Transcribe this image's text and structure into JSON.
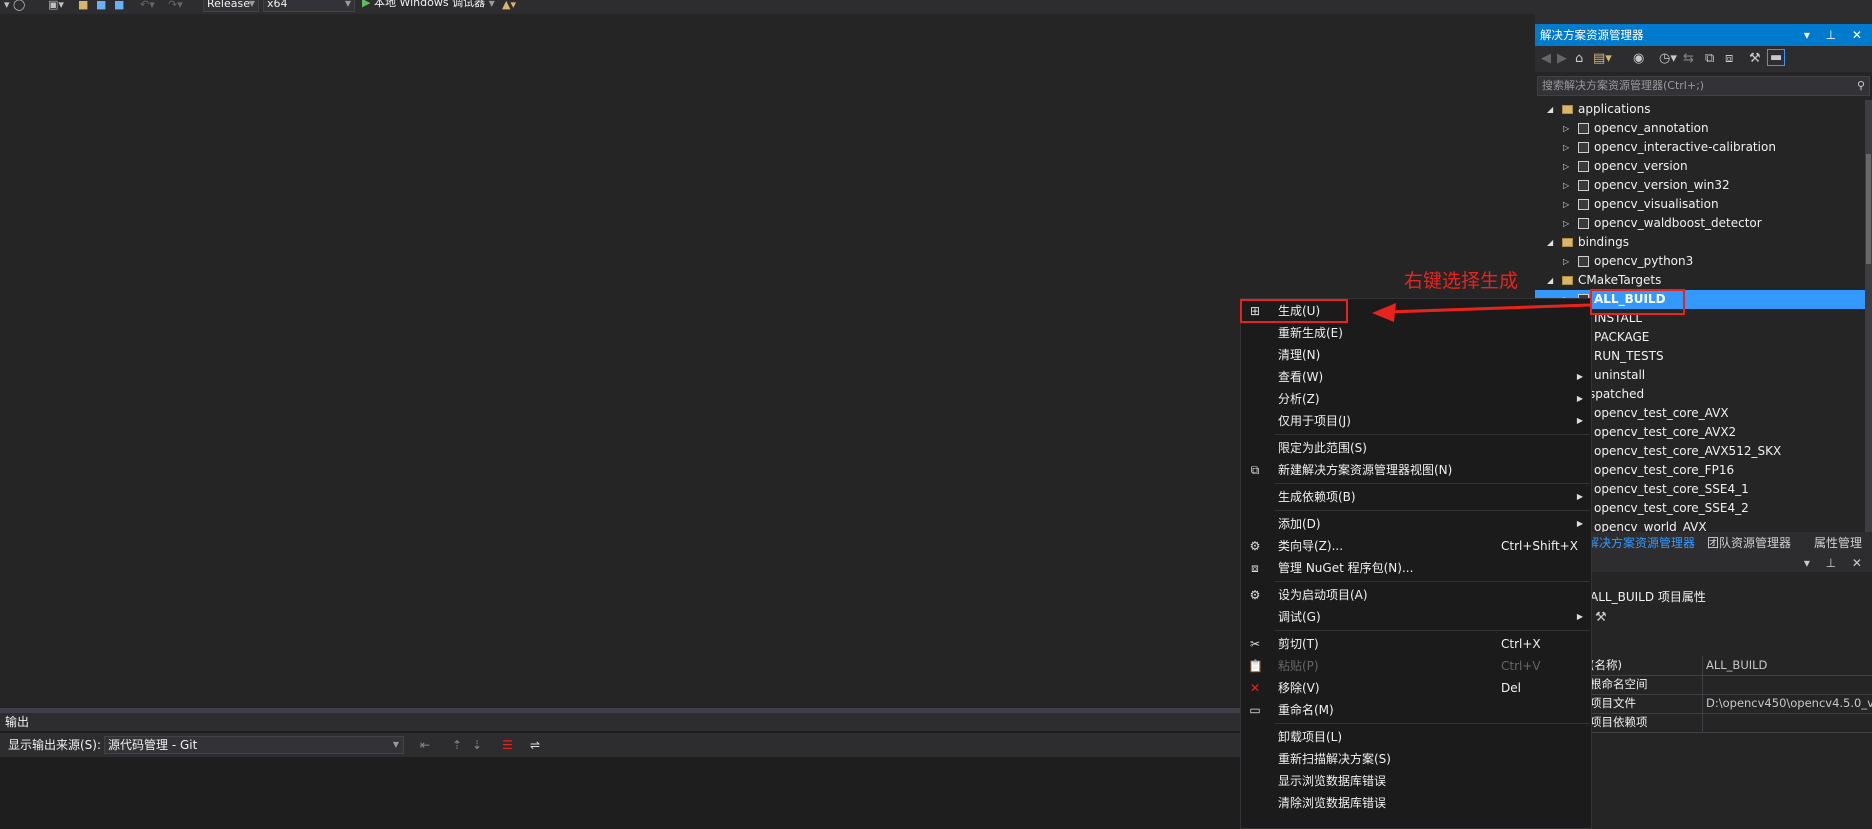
{
  "toolbar": {
    "configuration": "Release",
    "platform": "x64",
    "debugger_label": "本地 Windows 调试器"
  },
  "solution_explorer": {
    "title": "解决方案资源管理器",
    "search_placeholder": "搜索解决方案资源管理器(Ctrl+;)",
    "tree": [
      {
        "label": "applications",
        "type": "folder",
        "level": 0,
        "expanded": true
      },
      {
        "label": "opencv_annotation",
        "type": "project",
        "level": 1
      },
      {
        "label": "opencv_interactive-calibration",
        "type": "project",
        "level": 1
      },
      {
        "label": "opencv_version",
        "type": "project",
        "level": 1
      },
      {
        "label": "opencv_version_win32",
        "type": "project",
        "level": 1
      },
      {
        "label": "opencv_visualisation",
        "type": "project",
        "level": 1
      },
      {
        "label": "opencv_waldboost_detector",
        "type": "project",
        "level": 1
      },
      {
        "label": "bindings",
        "type": "folder",
        "level": 0,
        "expanded": true
      },
      {
        "label": "opencv_python3",
        "type": "project",
        "level": 1
      },
      {
        "label": "CMakeTargets",
        "type": "folder",
        "level": 0,
        "expanded": true
      },
      {
        "label": "ALL_BUILD",
        "type": "project",
        "level": 1,
        "selected": true
      },
      {
        "label": "INSTALL",
        "type": "project",
        "level": 1
      },
      {
        "label": "PACKAGE",
        "type": "project",
        "level": 1
      },
      {
        "label": "RUN_TESTS",
        "type": "project",
        "level": 1
      },
      {
        "label": "uninstall",
        "type": "project",
        "level": 1
      },
      {
        "label": "dispatched",
        "type": "folder",
        "level": 0,
        "expanded": true
      },
      {
        "label": "opencv_test_core_AVX",
        "type": "project",
        "level": 1
      },
      {
        "label": "opencv_test_core_AVX2",
        "type": "project",
        "level": 1
      },
      {
        "label": "opencv_test_core_AVX512_SKX",
        "type": "project",
        "level": 1
      },
      {
        "label": "opencv_test_core_FP16",
        "type": "project",
        "level": 1
      },
      {
        "label": "opencv_test_core_SSE4_1",
        "type": "project",
        "level": 1
      },
      {
        "label": "opencv_test_core_SSE4_2",
        "type": "project",
        "level": 1
      },
      {
        "label": "opencv_world_AVX",
        "type": "project",
        "level": 1
      }
    ],
    "tabs": [
      "解决方案资源管理器",
      "团队资源管理器",
      "属性管理器"
    ]
  },
  "properties": {
    "object": "ALL_BUILD 项目属性",
    "rows": [
      {
        "key": "(名称)",
        "value": "ALL_BUILD"
      },
      {
        "key": "根命名空间",
        "value": ""
      },
      {
        "key": "项目文件",
        "value": "D:\\opencv450\\opencv4.5.0_v"
      },
      {
        "key": "项目依赖项",
        "value": ""
      }
    ]
  },
  "output": {
    "title": "输出",
    "source_label": "显示输出来源(S):",
    "source_value": "源代码管理 - Git"
  },
  "context_menu": {
    "items": [
      {
        "label": "生成(U)",
        "icon": "build-icon"
      },
      {
        "label": "重新生成(E)"
      },
      {
        "label": "清理(N)"
      },
      {
        "label": "查看(W)",
        "submenu": true
      },
      {
        "label": "分析(Z)",
        "submenu": true
      },
      {
        "label": "仅用于项目(J)",
        "submenu": true
      },
      {
        "separator": true
      },
      {
        "label": "限定为此范围(S)"
      },
      {
        "label": "新建解决方案资源管理器视图(N)",
        "icon": "new-view-icon"
      },
      {
        "separator": true
      },
      {
        "label": "生成依赖项(B)",
        "submenu": true
      },
      {
        "separator": true
      },
      {
        "label": "添加(D)",
        "submenu": true
      },
      {
        "label": "类向导(Z)...",
        "shortcut": "Ctrl+Shift+X",
        "icon": "class-wizard-icon"
      },
      {
        "label": "管理 NuGet 程序包(N)...",
        "icon": "nuget-icon"
      },
      {
        "separator": true
      },
      {
        "label": "设为启动项目(A)",
        "icon": "gear-icon"
      },
      {
        "label": "调试(G)",
        "submenu": true
      },
      {
        "separator": true
      },
      {
        "label": "剪切(T)",
        "shortcut": "Ctrl+X",
        "icon": "scissors-icon"
      },
      {
        "label": "粘贴(P)",
        "shortcut": "Ctrl+V",
        "icon": "paste-icon",
        "disabled": true
      },
      {
        "label": "移除(V)",
        "shortcut": "Del",
        "icon": "remove-icon"
      },
      {
        "label": "重命名(M)",
        "icon": "rename-icon"
      },
      {
        "separator": true
      },
      {
        "label": "卸载项目(L)"
      },
      {
        "label": "重新扫描解决方案(S)"
      },
      {
        "label": "显示浏览数据库错误"
      },
      {
        "label": "清除浏览数据库错误"
      }
    ]
  },
  "annotation": {
    "text": "右键选择生成",
    "color": "#e8231d"
  },
  "colors": {
    "accent": "#007acc",
    "selection": "#3399ff",
    "background": "#2d2d30"
  }
}
